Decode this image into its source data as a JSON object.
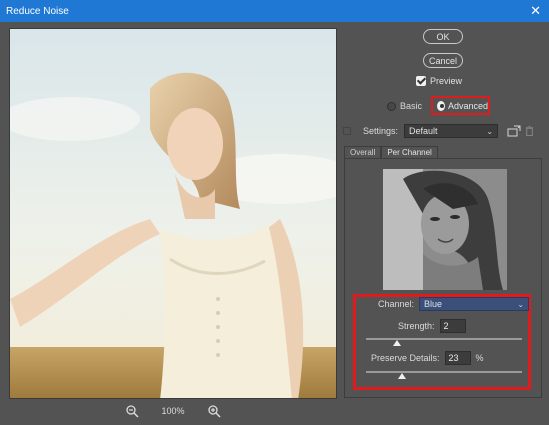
{
  "window": {
    "title": "Reduce Noise",
    "close_glyph": "✕"
  },
  "buttons": {
    "ok": "OK",
    "cancel": "Cancel"
  },
  "preview_toggle": {
    "label": "Preview",
    "checked": true
  },
  "mode": {
    "basic_label": "Basic",
    "advanced_label": "Advanced",
    "selected": "Advanced"
  },
  "settings": {
    "label": "Settings:",
    "value": "Default"
  },
  "tabs": [
    {
      "label": "Overall"
    },
    {
      "label": "Per Channel"
    }
  ],
  "channel": {
    "label": "Channel:",
    "value": "Blue"
  },
  "strength": {
    "label": "Strength:",
    "value": "2",
    "level": 0.2
  },
  "preserve_details": {
    "label": "Preserve Details:",
    "value": "23",
    "unit": "%",
    "level": 0.23
  },
  "zoom": {
    "value": "100%"
  },
  "icons": {
    "close": "close-icon",
    "zoom_out": "zoom-out-icon",
    "zoom_in": "zoom-in-icon",
    "save_preset": "save-preset-icon",
    "delete": "trash-icon",
    "dropdown": "chevron-down-icon"
  },
  "colors": {
    "titlebar": "#1e78d4",
    "highlight": "#e01b1b",
    "panel": "#535353"
  }
}
